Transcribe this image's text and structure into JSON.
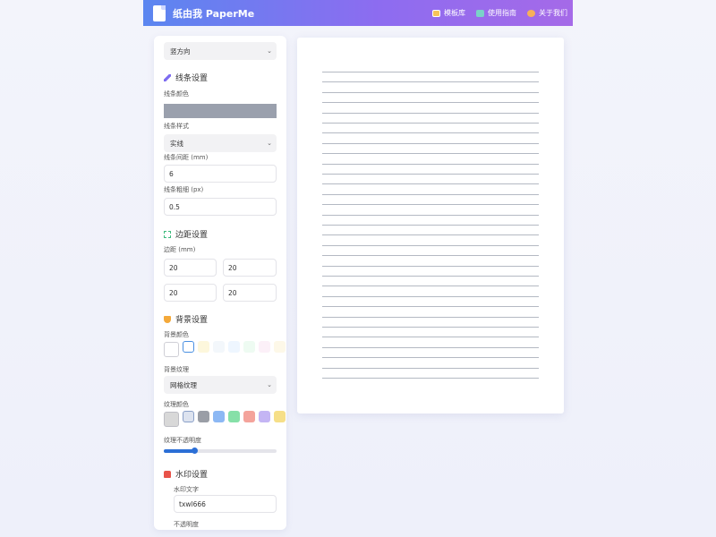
{
  "header": {
    "logo_text": "纸由我 PaperMe",
    "nav": [
      {
        "label": "模板库",
        "icon": "template-book-icon"
      },
      {
        "label": "使用指南",
        "icon": "guide-book-icon"
      },
      {
        "label": "关于我们",
        "icon": "people-icon"
      }
    ]
  },
  "sidebar": {
    "paper_direction": "竖方向",
    "line_settings": {
      "title": "线条设置",
      "color_label": "线条颜色",
      "color": "#9aa0ad",
      "style_label": "线条样式",
      "style_value": "实线",
      "spacing_label": "线条间距 (mm)",
      "spacing_value": "6",
      "width_label": "线条粗细 (px)",
      "width_value": "0.5"
    },
    "margin_settings": {
      "title": "边距设置",
      "label": "边距 (mm)",
      "values": [
        "20",
        "20",
        "20",
        "20"
      ]
    },
    "background_settings": {
      "title": "背景设置",
      "color_label": "背景颜色",
      "bg_colors": [
        "#ffffff",
        "#ffffff",
        "#fdf7dc",
        "#f3f7fb",
        "#eef6ff",
        "#eefbf2",
        "#fcf0f8",
        "#fdf8e8"
      ],
      "texture_label": "背景纹理",
      "texture_value": "网格纹理",
      "texture_color_label": "纹理颜色",
      "texture_colors": [
        "#d8d8d8",
        "#dde3ef",
        "#9a9ea6",
        "#8cb8f4",
        "#86e0a8",
        "#f4a39b",
        "#c4b5f4",
        "#f6df88"
      ],
      "opacity_label": "纹理不透明度",
      "opacity_value": 0.27
    },
    "watermark_settings": {
      "title": "水印设置",
      "text_label": "水印文字",
      "text_value": "txwl666",
      "opacity_label": "不透明度"
    }
  },
  "preview": {
    "line_count": 31,
    "line_color": "#b4b9c3"
  }
}
